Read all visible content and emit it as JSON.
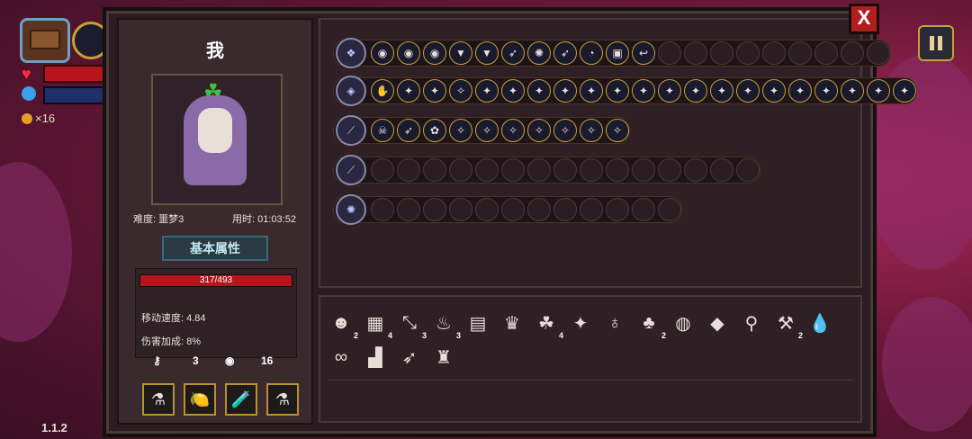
{
  "hud": {
    "coins": "×16",
    "version": "1.1.2"
  },
  "close_label": "X",
  "player": {
    "name": "我",
    "difficulty": "难度: 噩梦3",
    "time": "用时: 01:03:52",
    "tab_label": "基本属性",
    "hp": "317/493",
    "hp_fraction": 0.643,
    "move_speed": "移动速度: 4.84",
    "damage_bonus": "伤害加成: 8%",
    "keys": "3",
    "coins": "16"
  },
  "potions": [
    "⚗",
    "🍋",
    "🧪",
    "⚗"
  ],
  "skill_rows": [
    {
      "icon": "❖",
      "slots": [
        "◉",
        "◉",
        "◉",
        "▼",
        "▼",
        "➶",
        "✺",
        "➶",
        "◔",
        "▣",
        "↩"
      ],
      "empty": 9
    },
    {
      "icon": "◈",
      "slots": [
        "✋",
        "✦",
        "✦",
        "✧",
        "✦",
        "✦",
        "✦",
        "✦",
        "✦",
        "✦",
        "✦",
        "✦",
        "✦",
        "✦",
        "✦",
        "✦",
        "✦",
        "✦",
        "✦",
        "✦",
        "✦"
      ],
      "empty": 0
    },
    {
      "icon": "⟋",
      "slots": [
        "☠",
        "➶",
        "✿",
        "✧",
        "✧",
        "✧",
        "✧",
        "✧",
        "✧",
        "✧"
      ],
      "empty": 0
    },
    {
      "icon": "⟋",
      "slots": [],
      "empty": 15
    },
    {
      "icon": "✺",
      "slots": [],
      "empty": 12
    }
  ],
  "items": [
    {
      "icon": "☻",
      "count": "2"
    },
    {
      "icon": "▦",
      "count": "4"
    },
    {
      "icon": "⤡",
      "count": "3"
    },
    {
      "icon": "♨",
      "count": "3"
    },
    {
      "icon": "▤",
      "count": ""
    },
    {
      "icon": "♛",
      "count": ""
    },
    {
      "icon": "☘",
      "count": "4"
    },
    {
      "icon": "✦",
      "count": ""
    },
    {
      "icon": "♁",
      "count": ""
    },
    {
      "icon": "♣",
      "count": "2"
    },
    {
      "icon": "◍",
      "count": ""
    },
    {
      "icon": "◆",
      "count": ""
    },
    {
      "icon": "⚲",
      "count": ""
    },
    {
      "icon": "⚒",
      "count": "2"
    },
    {
      "icon": "💧",
      "count": ""
    },
    {
      "icon": "∞",
      "count": ""
    },
    {
      "icon": "▟",
      "count": ""
    },
    {
      "icon": "➶",
      "count": ""
    },
    {
      "icon": "♜",
      "count": ""
    }
  ]
}
